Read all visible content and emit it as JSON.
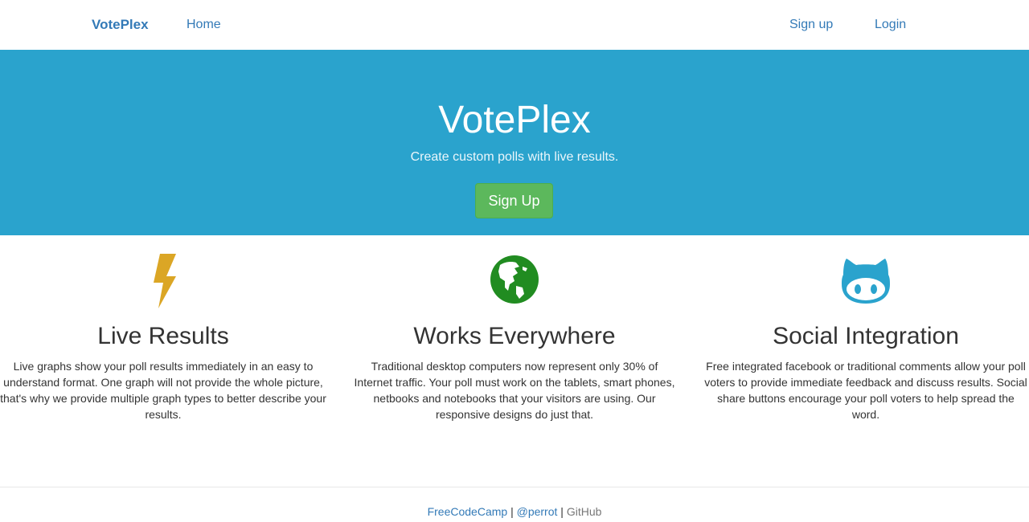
{
  "navbar": {
    "brand": "VotePlex",
    "home": "Home",
    "signup": "Sign up",
    "login": "Login"
  },
  "hero": {
    "title": "VotePlex",
    "subtitle": "Create custom polls with live results.",
    "button": "Sign Up",
    "background_color": "#2aa3cd",
    "button_color": "#5cb85c"
  },
  "features": [
    {
      "icon": "lightning-bolt-icon",
      "icon_color": "#dba625",
      "title": "Live Results",
      "text": "Live graphs show your poll results immediately in an easy to understand format. One graph will not provide the whole picture, that's why we provide multiple graph types to better describe your results."
    },
    {
      "icon": "globe-icon",
      "icon_color": "#218c21",
      "title": "Works Everywhere",
      "text": "Traditional desktop computers now represent only 30% of Internet traffic. Your poll must work on the tablets, smart phones, netbooks and notebooks that your visitors are using. Our responsive designs do just that."
    },
    {
      "icon": "github-octocat-icon",
      "icon_color": "#2aa3cd",
      "title": "Social Integration",
      "text": "Free integrated facebook or traditional comments allow your poll voters to provide immediate feedback and discuss results. Social share buttons encourage your poll voters to help spread the word."
    }
  ],
  "footer": {
    "link1": "FreeCodeCamp",
    "sep1": "|",
    "link2": "@perrot",
    "sep2": "|",
    "text3": "GitHub"
  }
}
